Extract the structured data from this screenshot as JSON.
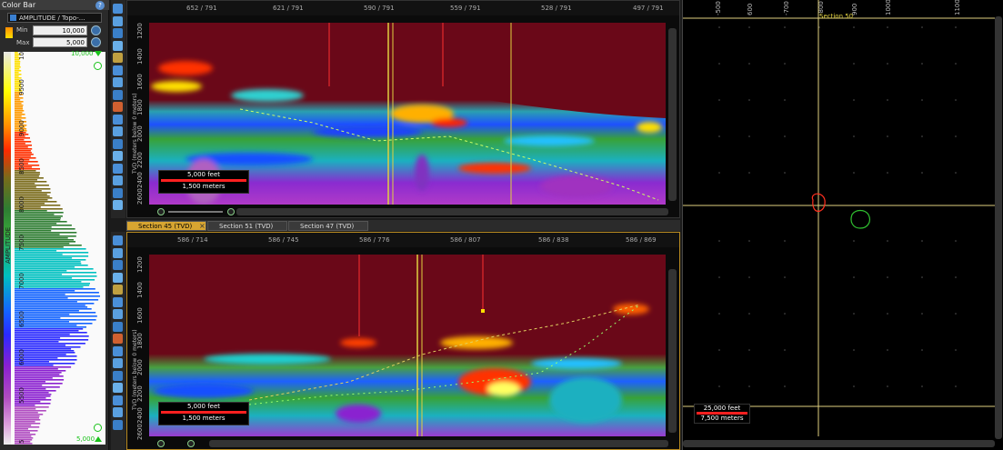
{
  "colorbar": {
    "title": "Color Bar",
    "help": "?",
    "attribute": "AMPLITUDE / Topo-...",
    "min_label": "Min",
    "min_value": "10,000",
    "max_label": "Max",
    "max_value": "5,000",
    "top_value": "10,000",
    "bottom_value": "5,000",
    "axis_label": "AMPLITUDE",
    "ticks": [
      "10",
      "9500",
      "9000",
      "8500",
      "8000",
      "7500",
      "7000",
      "6500",
      "6000",
      "5500",
      "5"
    ]
  },
  "top_section": {
    "trace_labels": [
      "652 / 791",
      "621 / 791",
      "590 / 791",
      "559 / 791",
      "528 / 791",
      "497 / 791"
    ],
    "depth_labels": [
      "1200",
      "1400",
      "1600",
      "1800",
      "2000",
      "2200",
      "2400",
      "2600"
    ],
    "y_axis_title": "TVD (meters below 0 meters)",
    "scale_feet": "5,000 feet",
    "scale_meters": "1,500 meters"
  },
  "tabs": [
    {
      "label": "Section 45 (TVD)",
      "active": true
    },
    {
      "label": "Section 51 (TVD)",
      "active": false
    },
    {
      "label": "Section 47 (TVD)",
      "active": false
    }
  ],
  "bottom_section": {
    "trace_labels": [
      "586 / 714",
      "586 / 745",
      "586 / 776",
      "586 / 807",
      "586 / 838",
      "586 / 869"
    ],
    "depth_labels": [
      "1200",
      "1400",
      "1600",
      "1800",
      "2000",
      "2200",
      "2400",
      "2600"
    ],
    "y_axis_title": "TVD (meters below 0 meters)",
    "scale_feet": "5,000 feet",
    "scale_meters": "1,500 meters"
  },
  "map": {
    "x_ticks": [
      "-500",
      "600",
      "-700",
      "-800",
      "900",
      "1000",
      "1100"
    ],
    "section_label": "Section 50",
    "scale_feet": "25,000 feet",
    "scale_meters": "7,500 meters"
  }
}
